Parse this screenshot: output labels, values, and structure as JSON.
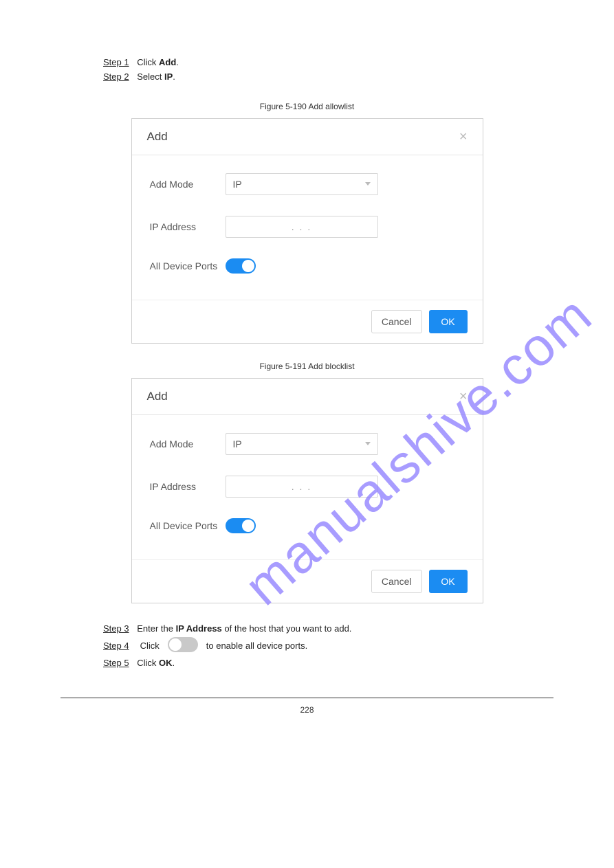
{
  "watermark": "manualshive.com",
  "steps_top": {
    "s1": {
      "label": "Step 1",
      "text_a": "Click ",
      "bold": "Add",
      "text_b": "."
    },
    "s2": {
      "label": "Step 2",
      "text_a": "Select ",
      "bold": "IP",
      "text_b": "."
    }
  },
  "figcap1": "Figure 5-190 Add allowlist",
  "dialog": {
    "title": "Add",
    "close": "×",
    "add_mode_label": "Add Mode",
    "add_mode_value": "IP",
    "ip_label": "IP Address",
    "ip_placeholder": ".            .            .",
    "ports_label": "All Device Ports",
    "cancel": "Cancel",
    "ok": "OK"
  },
  "figcap2": "Figure 5-191 Add blocklist",
  "steps_bottom": {
    "s3": {
      "label": "Step 3",
      "pre": "Enter the ",
      "bold1": "IP Address",
      "post1": " of the host that you want to add."
    },
    "s4": {
      "label": "Step 4",
      "toggle_note": " to enable all device ports."
    },
    "s5": {
      "label": "Step 5",
      "pre": "Click ",
      "bold1": "OK",
      "post1": "."
    }
  },
  "page_number": "228"
}
